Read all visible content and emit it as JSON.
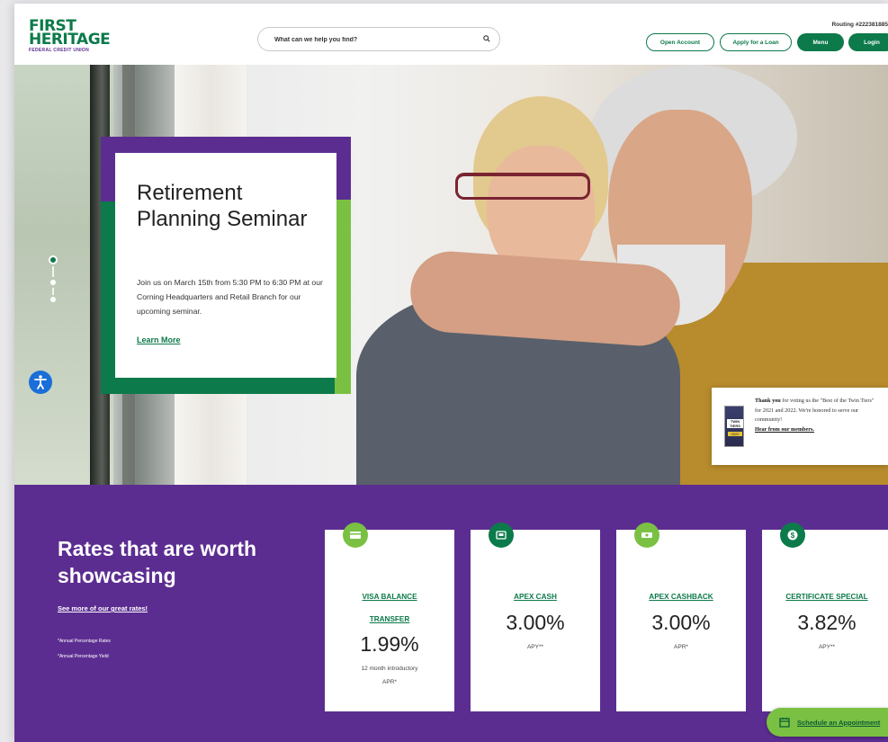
{
  "header": {
    "logo_line1": "FIRST",
    "logo_line2": "HERITAGE",
    "logo_line3": "FEDERAL CREDIT UNION",
    "search_placeholder": "What can we help you find?",
    "routing": "Routing #222381885",
    "buttons": {
      "open_account": "Open Account",
      "apply_loan": "Apply for a Loan",
      "menu": "Menu",
      "login": "Login"
    }
  },
  "hero": {
    "title": "Retirement Planning Seminar",
    "body": "Join us on March 15th from 5:30 PM to 6:30 PM at our Corning Headquarters and Retail Branch for our upcoming seminar.",
    "link": "Learn More",
    "award": {
      "thank": "Thank you",
      "text": " for voting us the \"Best of the Twin Tiers\" for 2021 and 2022. We're honored to serve our community!",
      "link": "Hear from our members.",
      "badge_line1": "TWIN TIERS",
      "badge_line2": "2022"
    }
  },
  "rates": {
    "title": "Rates that are worth showcasing",
    "link": "See more of our great rates!",
    "footnote1": "*Annual Percentage Rates",
    "footnote2": "*Annual Percentage Yield",
    "cards": [
      {
        "link1": "VISA BALANCE",
        "link2": "TRANSFER",
        "rate": "1.99%",
        "unit1": "12 month introductory",
        "unit2": "APR*",
        "icon": "credit-card-icon",
        "color": "#7ac143"
      },
      {
        "link1": "APEX CASH",
        "rate": "3.00%",
        "unit1": "APY**",
        "icon": "cash-register-icon",
        "color": "#0c7a4a"
      },
      {
        "link1": "APEX CASHBACK",
        "rate": "3.00%",
        "unit1": "APR*",
        "icon": "money-icon",
        "color": "#7ac143"
      },
      {
        "link1": "CERTIFICATE SPECIAL",
        "rate": "3.82%",
        "unit1": "APY**",
        "icon": "dollar-coin-icon",
        "color": "#0c7a4a"
      }
    ]
  },
  "schedule": "Schedule an Appointment"
}
